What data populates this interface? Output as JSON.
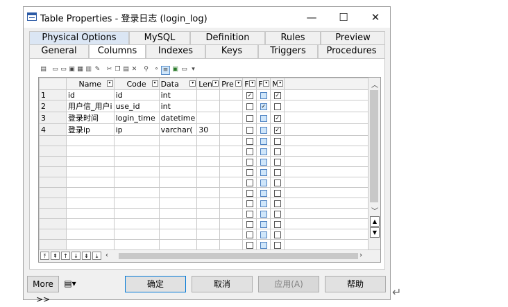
{
  "window": {
    "title": "Table Properties - 登录日志 (login_log)"
  },
  "tabs_row1": [
    "Physical Options",
    "MySQL",
    "Definition",
    "Rules",
    "Preview"
  ],
  "tabs_row2": [
    "General",
    "Columns",
    "Indexes",
    "Keys",
    "Triggers",
    "Procedures"
  ],
  "active_tab": "Columns",
  "columns_header": {
    "name": "Name",
    "code": "Code",
    "data": "Data",
    "len": "Len",
    "pre": "Pre",
    "f1": "F",
    "f2": "F",
    "m": "M"
  },
  "rows": [
    {
      "num": "1",
      "name": "id",
      "code": "id",
      "data": "int",
      "len": "",
      "c1": true,
      "c2": false,
      "c3": true
    },
    {
      "num": "2",
      "name": "用户信_用户i",
      "code": "use_id",
      "data": "int",
      "len": "",
      "c1": false,
      "c2": true,
      "c3": false
    },
    {
      "num": "3",
      "name": "登录时间",
      "code": "login_time",
      "data": "datetime",
      "len": "",
      "c1": false,
      "c2": false,
      "c3": true
    },
    {
      "num": "4",
      "name": "登录ip",
      "code": "ip",
      "data": "varchar(",
      "len": "30",
      "c1": false,
      "c2": false,
      "c3": true
    }
  ],
  "buttons": {
    "more": "More >>",
    "ok": "确定",
    "cancel": "取消",
    "apply": "应用(A)",
    "help": "帮助"
  }
}
